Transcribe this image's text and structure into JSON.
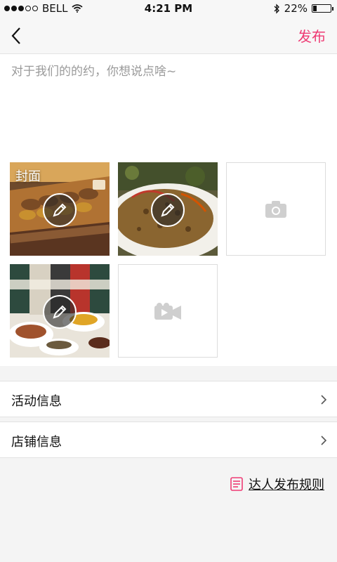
{
  "status_bar": {
    "carrier": "BELL",
    "time": "4:21 PM",
    "battery_percent_text": "22%",
    "battery_level": 0.22,
    "signal_bars_filled": 3,
    "signal_bars_total": 5
  },
  "nav": {
    "back_icon": "chevron-left-icon",
    "publish_label": "发布",
    "accent_color": "#ee3b74"
  },
  "post": {
    "text_value": "",
    "placeholder": "对于我们的的约，你想说点啥~"
  },
  "media": {
    "cover_label": "封面",
    "photos": [
      {
        "description": "grilled skewers on a wooden board",
        "has_cover_label": true
      },
      {
        "description": "fried rice on a white plate",
        "has_cover_label": false
      },
      {
        "description": "spice jars with spices on plates",
        "has_cover_label": false
      }
    ],
    "add_photo_icon": "camera-icon",
    "add_video_icon": "video-camera-icon"
  },
  "menu": {
    "items": [
      {
        "label": "活动信息"
      },
      {
        "label": "店铺信息"
      }
    ]
  },
  "rules": {
    "label": "达人发布规则",
    "icon": "document-icon"
  }
}
